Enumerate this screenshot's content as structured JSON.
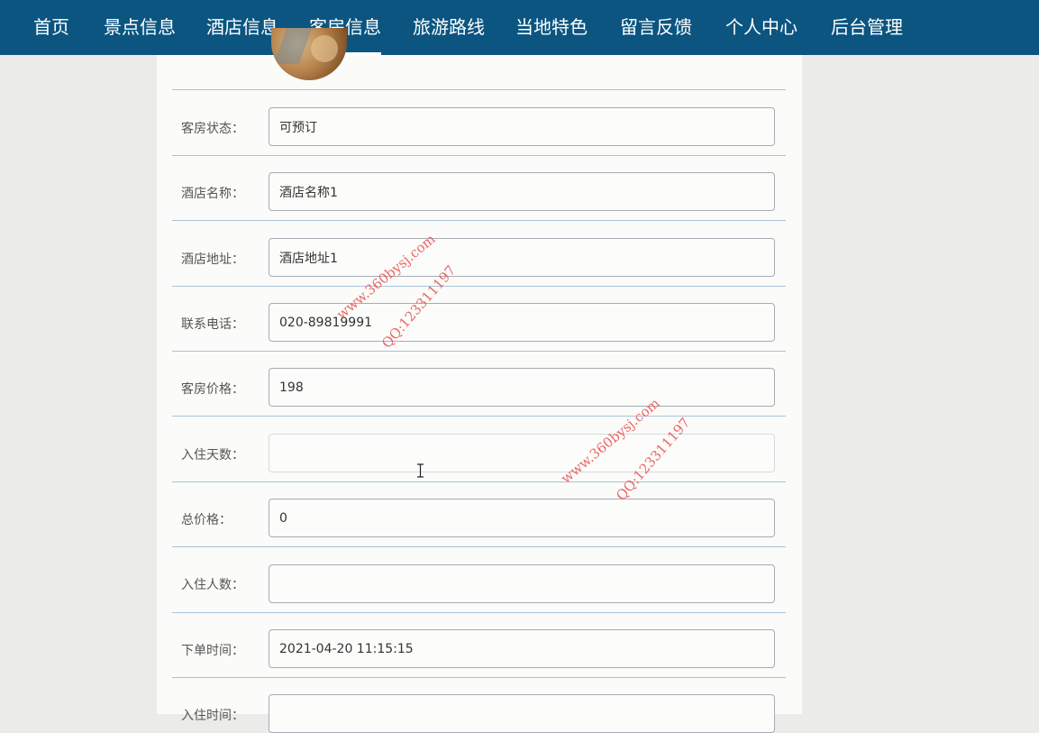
{
  "nav": {
    "items": [
      {
        "label": "首页",
        "active": false
      },
      {
        "label": "景点信息",
        "active": false
      },
      {
        "label": "酒店信息",
        "active": false
      },
      {
        "label": "客房信息",
        "active": true
      },
      {
        "label": "旅游路线",
        "active": false
      },
      {
        "label": "当地特色",
        "active": false
      },
      {
        "label": "留言反馈",
        "active": false
      },
      {
        "label": "个人中心",
        "active": false
      },
      {
        "label": "后台管理",
        "active": false
      }
    ]
  },
  "form": {
    "fields": [
      {
        "label": "客房状态：",
        "value": "可预订"
      },
      {
        "label": "酒店名称：",
        "value": "酒店名称1"
      },
      {
        "label": "酒店地址：",
        "value": "酒店地址1"
      },
      {
        "label": "联系电话：",
        "value": "020-89819991"
      },
      {
        "label": "客房价格：",
        "value": "198"
      },
      {
        "label": "入住天数：",
        "value": ""
      },
      {
        "label": "总价格：",
        "value": "0"
      },
      {
        "label": "入住人数：",
        "value": ""
      },
      {
        "label": "下单时间：",
        "value": "2021-04-20 11:15:15"
      },
      {
        "label": "入住时间：",
        "value": ""
      }
    ]
  },
  "watermarks": [
    {
      "site": "www.360bysj.com",
      "qq": "QQ:123311197"
    },
    {
      "site": "www.360bysj.com",
      "qq": "QQ:123311197"
    }
  ],
  "colors": {
    "navbar": "#0b5580",
    "background": "#ebebe9",
    "card": "#fbfbf9",
    "divider": "#a9c3d8",
    "watermark": "#e85858"
  }
}
